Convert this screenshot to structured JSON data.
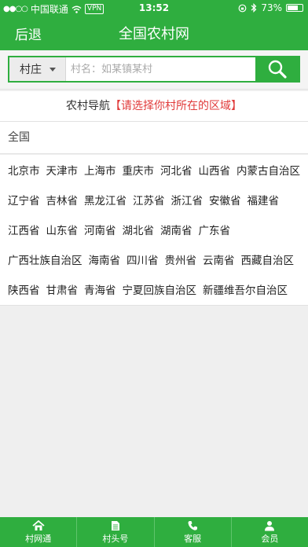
{
  "status": {
    "dots": "●●○○",
    "carrier": "中国联通",
    "vpn": "VPN",
    "time": "13:52",
    "battery": "73%",
    "battery_level": 0.73
  },
  "nav": {
    "back": "后退",
    "title": "全国农村网"
  },
  "search": {
    "select_label": "村庄",
    "placeholder": "村名：如某镇某村"
  },
  "region_nav": {
    "label": "农村导航",
    "hint": "【请选择你村所在的区域】"
  },
  "all_label": "全国",
  "provinces": [
    [
      "北京市",
      "天津市",
      "上海市",
      "重庆市",
      "河北省",
      "山西省",
      "内蒙古自治区"
    ],
    [
      "辽宁省",
      "吉林省",
      "黑龙江省",
      "江苏省",
      "浙江省",
      "安徽省",
      "福建省"
    ],
    [
      "江西省",
      "山东省",
      "河南省",
      "湖北省",
      "湖南省",
      "广东省"
    ],
    [
      "广西壮族自治区",
      "海南省",
      "四川省",
      "贵州省",
      "云南省",
      "西藏自治区"
    ],
    [
      "陕西省",
      "甘肃省",
      "青海省",
      "宁夏回族自治区",
      "新疆维吾尔自治区"
    ]
  ],
  "tabs": [
    "村网通",
    "村头号",
    "客服",
    "会员"
  ],
  "colors": {
    "brand": "#2fae3f",
    "hint": "#e13b3b"
  }
}
